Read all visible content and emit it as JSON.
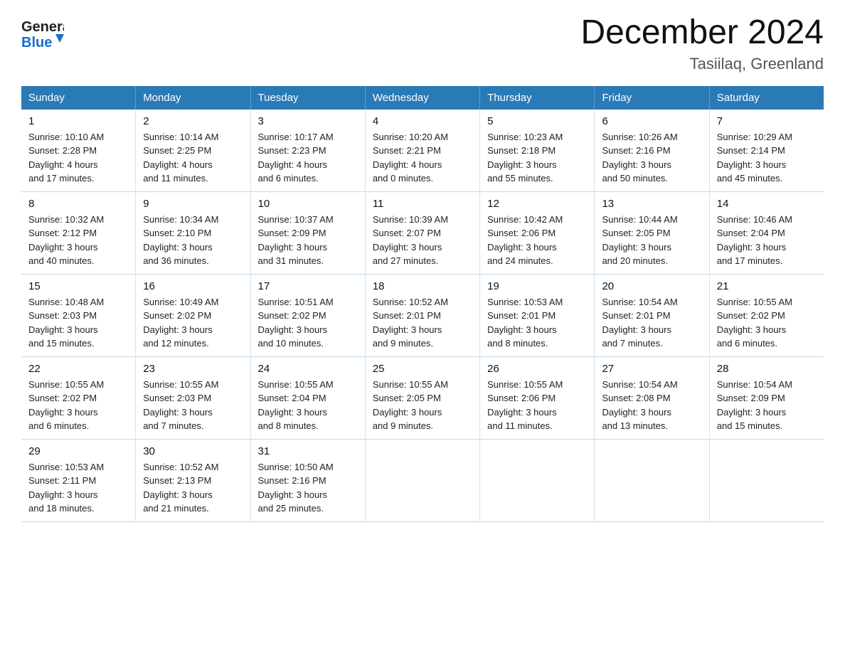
{
  "logo": {
    "text_general": "General",
    "text_blue": "Blue"
  },
  "title": "December 2024",
  "subtitle": "Tasiilaq, Greenland",
  "days_of_week": [
    "Sunday",
    "Monday",
    "Tuesday",
    "Wednesday",
    "Thursday",
    "Friday",
    "Saturday"
  ],
  "weeks": [
    [
      {
        "day": "1",
        "sunrise": "10:10 AM",
        "sunset": "2:28 PM",
        "daylight": "4 hours and 17 minutes."
      },
      {
        "day": "2",
        "sunrise": "10:14 AM",
        "sunset": "2:25 PM",
        "daylight": "4 hours and 11 minutes."
      },
      {
        "day": "3",
        "sunrise": "10:17 AM",
        "sunset": "2:23 PM",
        "daylight": "4 hours and 6 minutes."
      },
      {
        "day": "4",
        "sunrise": "10:20 AM",
        "sunset": "2:21 PM",
        "daylight": "4 hours and 0 minutes."
      },
      {
        "day": "5",
        "sunrise": "10:23 AM",
        "sunset": "2:18 PM",
        "daylight": "3 hours and 55 minutes."
      },
      {
        "day": "6",
        "sunrise": "10:26 AM",
        "sunset": "2:16 PM",
        "daylight": "3 hours and 50 minutes."
      },
      {
        "day": "7",
        "sunrise": "10:29 AM",
        "sunset": "2:14 PM",
        "daylight": "3 hours and 45 minutes."
      }
    ],
    [
      {
        "day": "8",
        "sunrise": "10:32 AM",
        "sunset": "2:12 PM",
        "daylight": "3 hours and 40 minutes."
      },
      {
        "day": "9",
        "sunrise": "10:34 AM",
        "sunset": "2:10 PM",
        "daylight": "3 hours and 36 minutes."
      },
      {
        "day": "10",
        "sunrise": "10:37 AM",
        "sunset": "2:09 PM",
        "daylight": "3 hours and 31 minutes."
      },
      {
        "day": "11",
        "sunrise": "10:39 AM",
        "sunset": "2:07 PM",
        "daylight": "3 hours and 27 minutes."
      },
      {
        "day": "12",
        "sunrise": "10:42 AM",
        "sunset": "2:06 PM",
        "daylight": "3 hours and 24 minutes."
      },
      {
        "day": "13",
        "sunrise": "10:44 AM",
        "sunset": "2:05 PM",
        "daylight": "3 hours and 20 minutes."
      },
      {
        "day": "14",
        "sunrise": "10:46 AM",
        "sunset": "2:04 PM",
        "daylight": "3 hours and 17 minutes."
      }
    ],
    [
      {
        "day": "15",
        "sunrise": "10:48 AM",
        "sunset": "2:03 PM",
        "daylight": "3 hours and 15 minutes."
      },
      {
        "day": "16",
        "sunrise": "10:49 AM",
        "sunset": "2:02 PM",
        "daylight": "3 hours and 12 minutes."
      },
      {
        "day": "17",
        "sunrise": "10:51 AM",
        "sunset": "2:02 PM",
        "daylight": "3 hours and 10 minutes."
      },
      {
        "day": "18",
        "sunrise": "10:52 AM",
        "sunset": "2:01 PM",
        "daylight": "3 hours and 9 minutes."
      },
      {
        "day": "19",
        "sunrise": "10:53 AM",
        "sunset": "2:01 PM",
        "daylight": "3 hours and 8 minutes."
      },
      {
        "day": "20",
        "sunrise": "10:54 AM",
        "sunset": "2:01 PM",
        "daylight": "3 hours and 7 minutes."
      },
      {
        "day": "21",
        "sunrise": "10:55 AM",
        "sunset": "2:02 PM",
        "daylight": "3 hours and 6 minutes."
      }
    ],
    [
      {
        "day": "22",
        "sunrise": "10:55 AM",
        "sunset": "2:02 PM",
        "daylight": "3 hours and 6 minutes."
      },
      {
        "day": "23",
        "sunrise": "10:55 AM",
        "sunset": "2:03 PM",
        "daylight": "3 hours and 7 minutes."
      },
      {
        "day": "24",
        "sunrise": "10:55 AM",
        "sunset": "2:04 PM",
        "daylight": "3 hours and 8 minutes."
      },
      {
        "day": "25",
        "sunrise": "10:55 AM",
        "sunset": "2:05 PM",
        "daylight": "3 hours and 9 minutes."
      },
      {
        "day": "26",
        "sunrise": "10:55 AM",
        "sunset": "2:06 PM",
        "daylight": "3 hours and 11 minutes."
      },
      {
        "day": "27",
        "sunrise": "10:54 AM",
        "sunset": "2:08 PM",
        "daylight": "3 hours and 13 minutes."
      },
      {
        "day": "28",
        "sunrise": "10:54 AM",
        "sunset": "2:09 PM",
        "daylight": "3 hours and 15 minutes."
      }
    ],
    [
      {
        "day": "29",
        "sunrise": "10:53 AM",
        "sunset": "2:11 PM",
        "daylight": "3 hours and 18 minutes."
      },
      {
        "day": "30",
        "sunrise": "10:52 AM",
        "sunset": "2:13 PM",
        "daylight": "3 hours and 21 minutes."
      },
      {
        "day": "31",
        "sunrise": "10:50 AM",
        "sunset": "2:16 PM",
        "daylight": "3 hours and 25 minutes."
      },
      {
        "day": "",
        "sunrise": "",
        "sunset": "",
        "daylight": ""
      },
      {
        "day": "",
        "sunrise": "",
        "sunset": "",
        "daylight": ""
      },
      {
        "day": "",
        "sunrise": "",
        "sunset": "",
        "daylight": ""
      },
      {
        "day": "",
        "sunrise": "",
        "sunset": "",
        "daylight": ""
      }
    ]
  ],
  "labels": {
    "sunrise": "Sunrise:",
    "sunset": "Sunset:",
    "daylight": "Daylight:"
  }
}
